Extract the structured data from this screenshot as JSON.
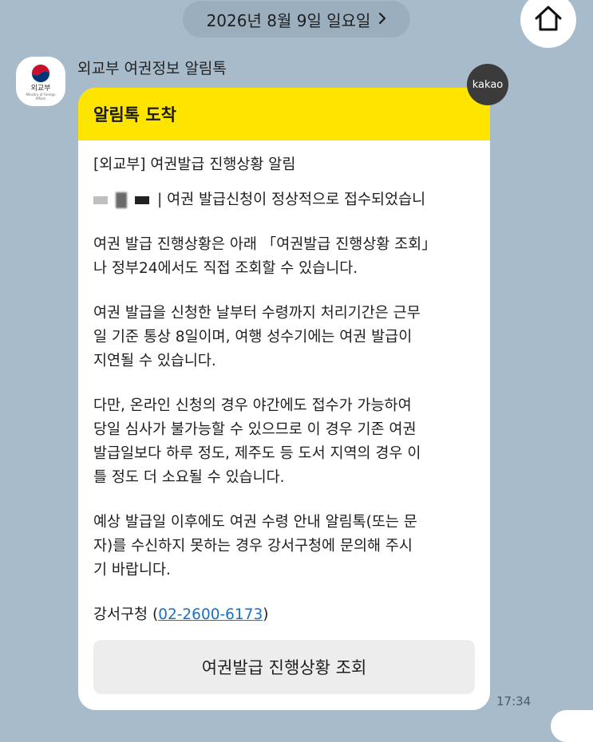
{
  "date_header": {
    "label": "2026년 8월 9일 일요일"
  },
  "sender": {
    "name": "외교부 여권정보 알림톡",
    "avatar_abbr": "외교부",
    "avatar_eng": "Ministry of Foreign Affairs"
  },
  "badge": {
    "label": "kakao"
  },
  "message": {
    "header": "알림톡 도착",
    "title": "[외교부] 여권발급 진행상황 알림",
    "received_text": "| 여권 발급신청이 정상적으로 접수되었습니",
    "received_text_cont": ".",
    "para1": "여권 발급 진행상황은 아래 「여권발급 진행상황 조회」\n나 정부24에서도 직접 조회할 수 있습니다.",
    "para2": "여권 발급을 신청한 날부터 수령까지 처리기간은 근무\n일 기준 통상 8일이며, 여행 성수기에는 여권 발급이\n지연될 수 있습니다.",
    "para3": "다만, 온라인 신청의 경우 야간에도 접수가 가능하여\n당일 심사가 불가능할 수 있으므로 이 경우 기존 여권\n발급일보다 하루 정도, 제주도 등 도서 지역의 경우 이\n틀 정도 더 소요될 수 있습니다.",
    "para4": "예상 발급일 이후에도 여권 수령 안내 알림톡(또는 문\n자)를 수신하지 못하는 경우 강서구청에 문의해 주시\n기 바랍니다.",
    "contact_prefix": "강서구청 (",
    "contact_phone": "02-2600-6173",
    "contact_suffix": ")",
    "button_label": "여권발급 진행상황 조회"
  },
  "timestamp": "17:34",
  "colors": {
    "background": "#a8bbcb",
    "header_yellow": "#fee500",
    "link_blue": "#1a6fc7"
  },
  "icons": [
    "home-icon",
    "chevron-right-icon",
    "government-emblem-icon"
  ]
}
